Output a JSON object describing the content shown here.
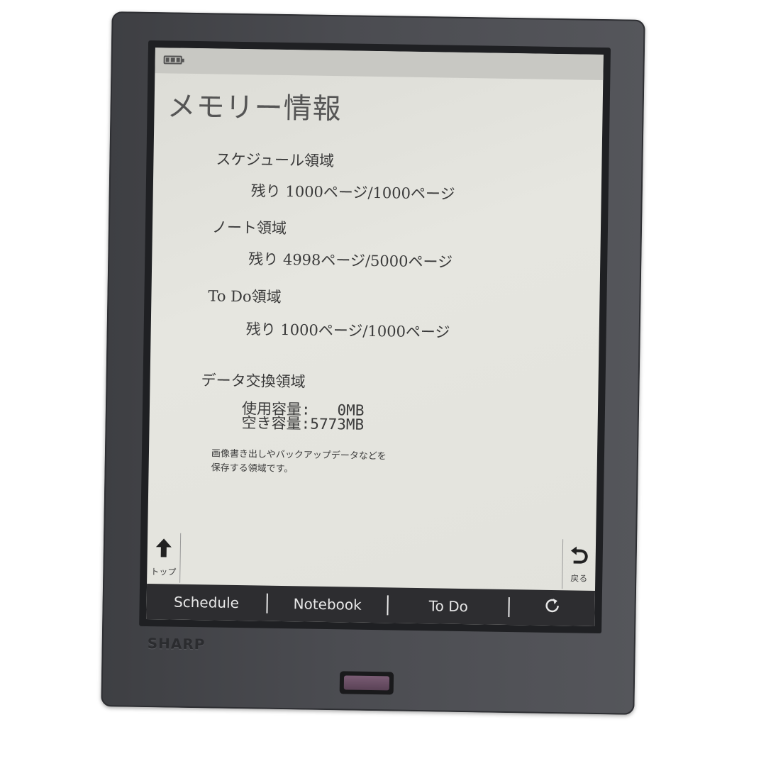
{
  "device": {
    "brand": "SHARP"
  },
  "status_bar": {
    "battery_icon": "battery-full-icon"
  },
  "page": {
    "title": "メモリー情報"
  },
  "sections": [
    {
      "label": "スケジュール領域",
      "remaining": "残り 1000ページ/1000ページ"
    },
    {
      "label": "ノート領域",
      "remaining": "残り 4998ページ/5000ページ"
    },
    {
      "label": "To Do領域",
      "remaining": "残り 1000ページ/1000ページ"
    }
  ],
  "data_exchange": {
    "label": "データ交換領域",
    "used": "使用容量:   0MB",
    "free": "空き容量:5773MB",
    "description_line1": "画像書き出しやバックアップデータなどを",
    "description_line2": "保存する領域です。"
  },
  "buttons": {
    "top_icon": "arrow-up-icon",
    "top_label": "トップ",
    "back_icon": "return-arrow-icon",
    "back_label": "戻る"
  },
  "nav": {
    "schedule": "Schedule",
    "notebook": "Notebook",
    "todo": "To Do",
    "refresh_icon": "refresh-icon"
  }
}
